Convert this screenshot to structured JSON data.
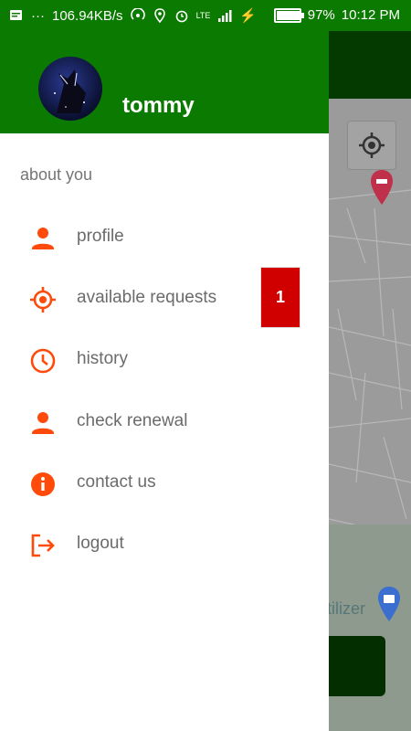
{
  "status_bar": {
    "speed": "106.94KB/s",
    "network": "LTE",
    "battery": "97%",
    "battery_level": 0.97,
    "time": "10:12 PM"
  },
  "drawer": {
    "username": "tommy",
    "section_title": "about you",
    "items": [
      {
        "label": "profile",
        "icon": "person-icon"
      },
      {
        "label": "available requests",
        "icon": "target-icon"
      },
      {
        "label": "history",
        "icon": "clock-icon"
      },
      {
        "label": "check renewal",
        "icon": "person-icon"
      },
      {
        "label": "contact us",
        "icon": "info-icon"
      },
      {
        "label": "logout",
        "icon": "logout-icon"
      }
    ],
    "requests_badge": "1"
  },
  "map": {
    "partial_label": "tilizer"
  },
  "colors": {
    "header_green": "#0b7a00",
    "accent_orange": "#ff4a0a",
    "badge_red": "#d10000"
  }
}
